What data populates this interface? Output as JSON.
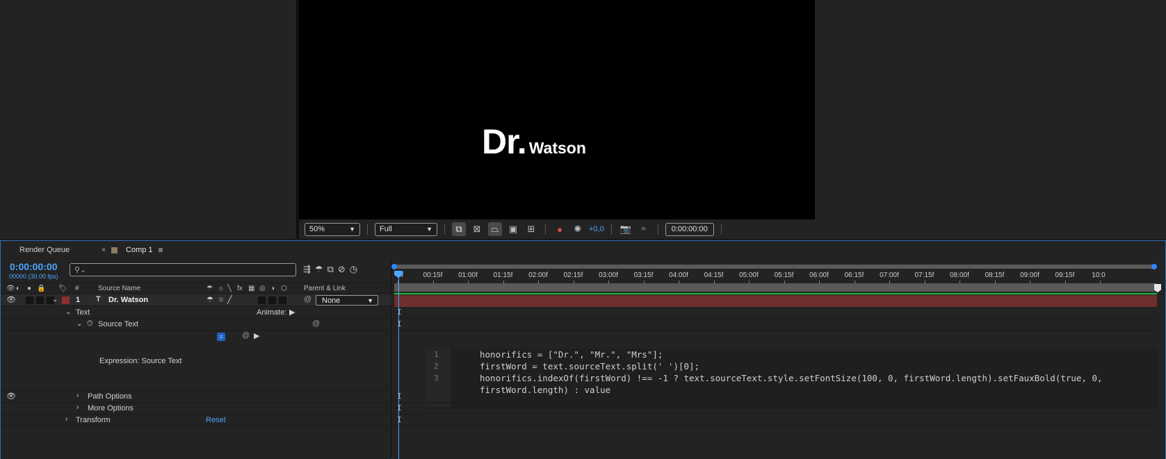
{
  "composition": {
    "text_big": "Dr.",
    "text_small": "Watson"
  },
  "viewer_toolbar": {
    "zoom": "50%",
    "resolution": "Full",
    "exposure": "+0,0",
    "timecode": "0:00:00:00"
  },
  "tabs": [
    {
      "label": "Render Queue"
    },
    {
      "label": "Comp 1"
    }
  ],
  "timeline": {
    "current_time": "0:00:00:00",
    "current_frame": "00000 (30.00 fps)",
    "search_placeholder": "",
    "columns": {
      "number": "#",
      "source_name": "Source Name",
      "parent_link": "Parent & Link"
    },
    "layer": {
      "number": "1",
      "name": "Dr. Watson",
      "parent": "None",
      "label_color": "#8c2f2f"
    },
    "properties": {
      "text": "Text",
      "animate": "Animate:",
      "source_text": "Source Text",
      "expression_label": "Expression: Source Text",
      "path_options": "Path Options",
      "more_options": "More Options",
      "transform": "Transform",
      "reset": "Reset"
    },
    "ruler_ticks": [
      "0f",
      "00:15f",
      "01:00f",
      "01:15f",
      "02:00f",
      "02:15f",
      "03:00f",
      "03:15f",
      "04:00f",
      "04:15f",
      "05:00f",
      "05:15f",
      "06:00f",
      "06:15f",
      "07:00f",
      "07:15f",
      "08:00f",
      "08:15f",
      "09:00f",
      "09:15f",
      "10:0"
    ],
    "code": {
      "line_numbers": [
        "1",
        "2",
        "3"
      ],
      "lines": [
        "honorifics = [\"Dr.\", \"Mr.\", \"Mrs\"];",
        "firstWord = text.sourceText.split(' ')[0];",
        "honorifics.indexOf(firstWord) !== -1 ? text.sourceText.style.setFontSize(100, 0, firstWord.length).setFauxBold(true, 0,",
        "firstWord.length) : value"
      ]
    }
  },
  "colors": {
    "accent_blue": "#4ba6ff",
    "layer_bar": "#6d2f2f",
    "green_line": "#1fbf3a"
  }
}
